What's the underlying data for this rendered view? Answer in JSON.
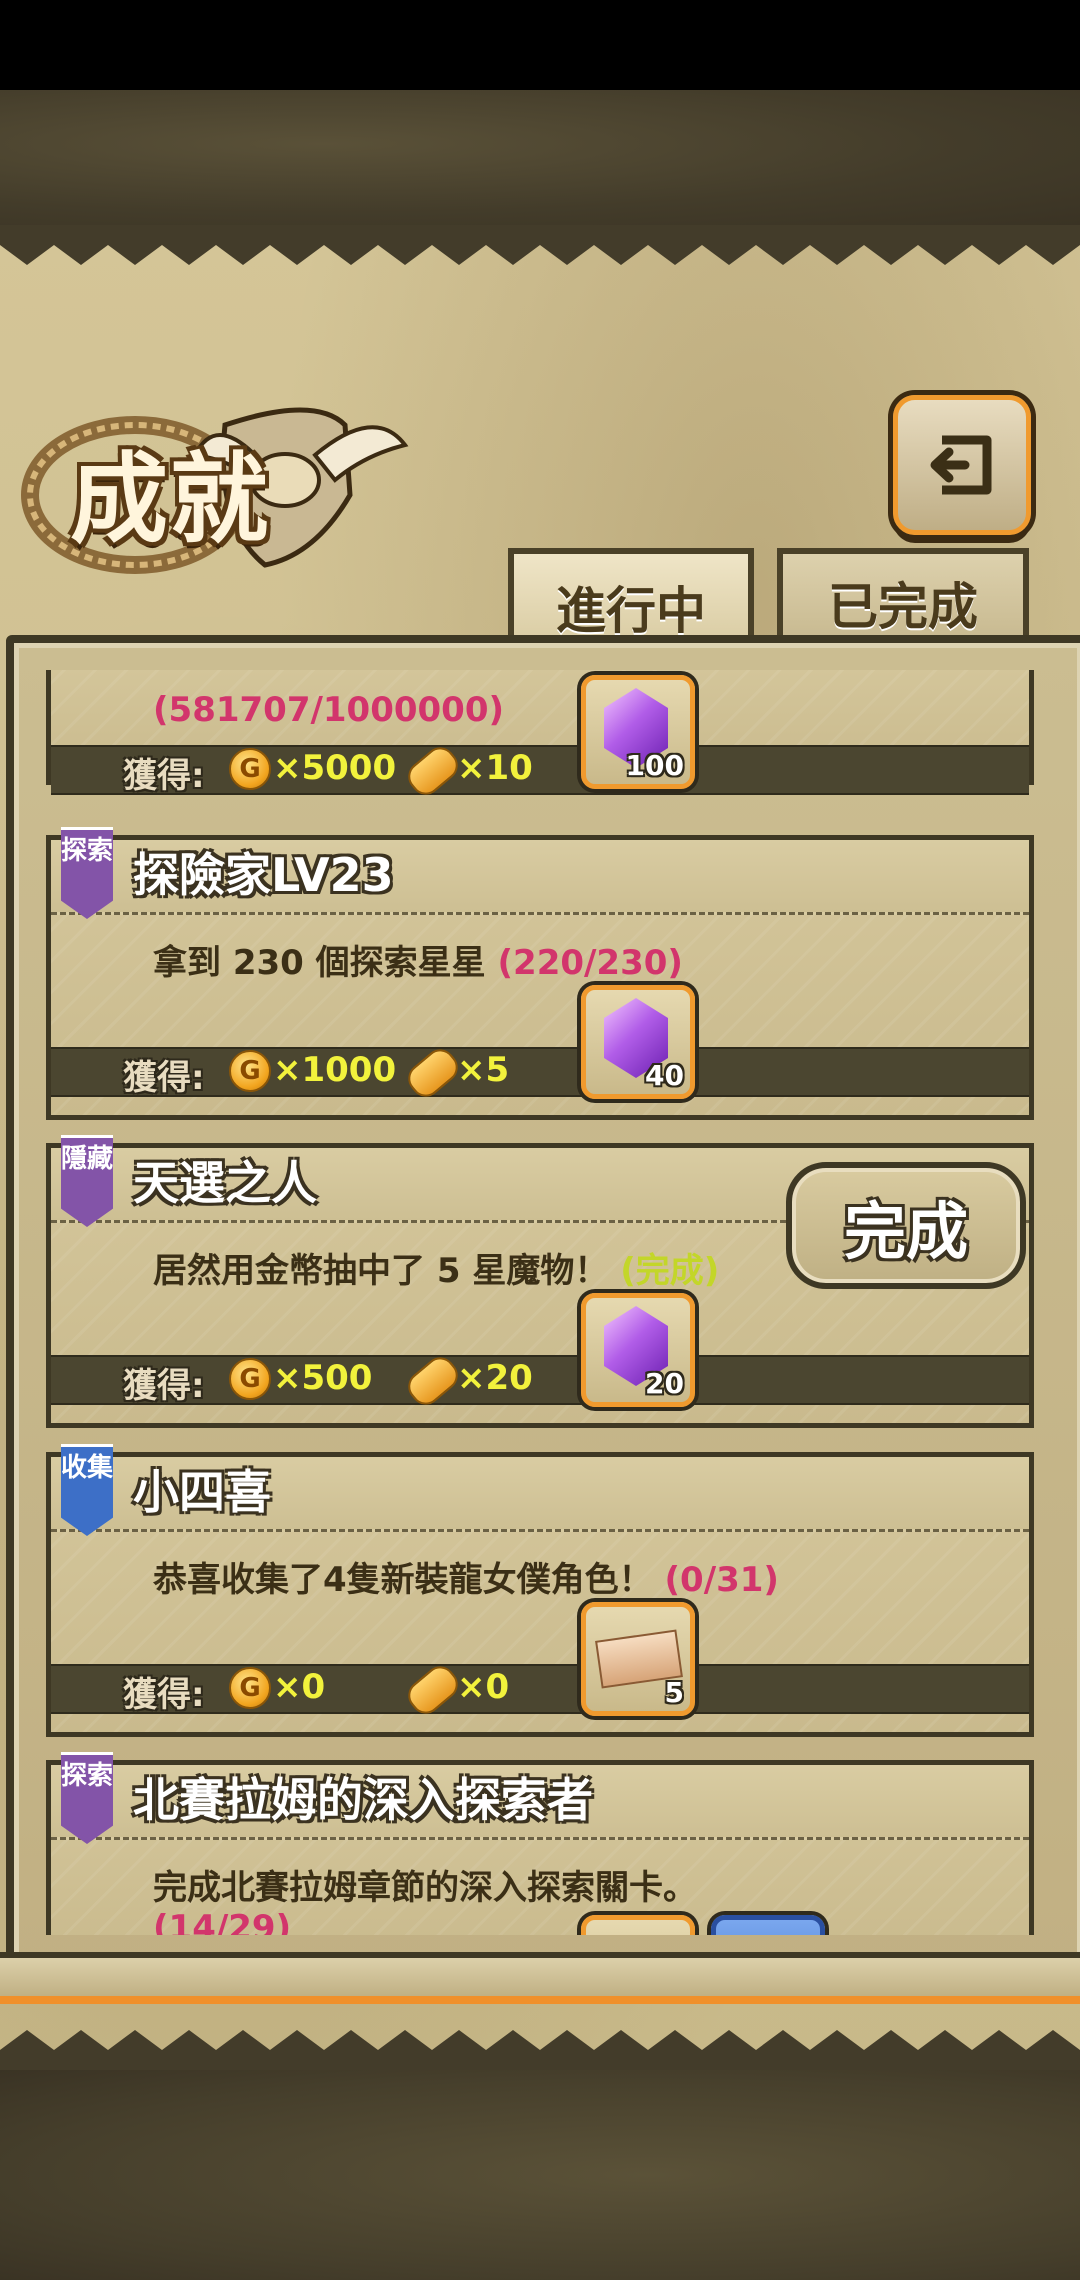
{
  "header": {
    "title": "成就",
    "back_icon": "return-arrow-icon"
  },
  "tabs": [
    {
      "label": "進行中",
      "active": true
    },
    {
      "label": "已完成",
      "active": false
    }
  ],
  "achievements": [
    {
      "progress": "(581707/1000000)",
      "reward_label": "獲得:",
      "coin_amount": "×5000",
      "bread_amount": "×10",
      "item": {
        "type": "purple-gem",
        "count": "100"
      }
    },
    {
      "badge": "探索",
      "badge_color": "#8354a8",
      "title": "探險家LV23",
      "desc": "拿到 230 個探索星星",
      "progress": "(220/230)",
      "reward_label": "獲得:",
      "coin_amount": "×1000",
      "bread_amount": "×5",
      "item": {
        "type": "purple-gem",
        "count": "40"
      }
    },
    {
      "badge": "隱藏",
      "badge_color": "#8354a8",
      "title": "天選之人",
      "desc": "居然用金幣抽中了 5 星魔物！",
      "progress": "(完成)",
      "reward_label": "獲得:",
      "coin_amount": "×500",
      "bread_amount": "×20",
      "item": {
        "type": "purple-gem",
        "count": "20"
      },
      "complete_button": "完成"
    },
    {
      "badge": "收集",
      "badge_color": "#3d6fc7",
      "title": "小四喜",
      "desc": "恭喜收集了4隻新裝龍女僕角色！",
      "progress": "(0/31)",
      "reward_label": "獲得:",
      "coin_amount": "×0",
      "bread_amount": "×0",
      "item": {
        "type": "ticket",
        "count": "5"
      }
    },
    {
      "badge": "探索",
      "badge_color": "#8354a8",
      "title": "北賽拉姆的深入探索者",
      "desc": "完成北賽拉姆章節的深入探索關卡。",
      "progress": "(14/29)"
    }
  ],
  "coin_icon_letter": "G"
}
